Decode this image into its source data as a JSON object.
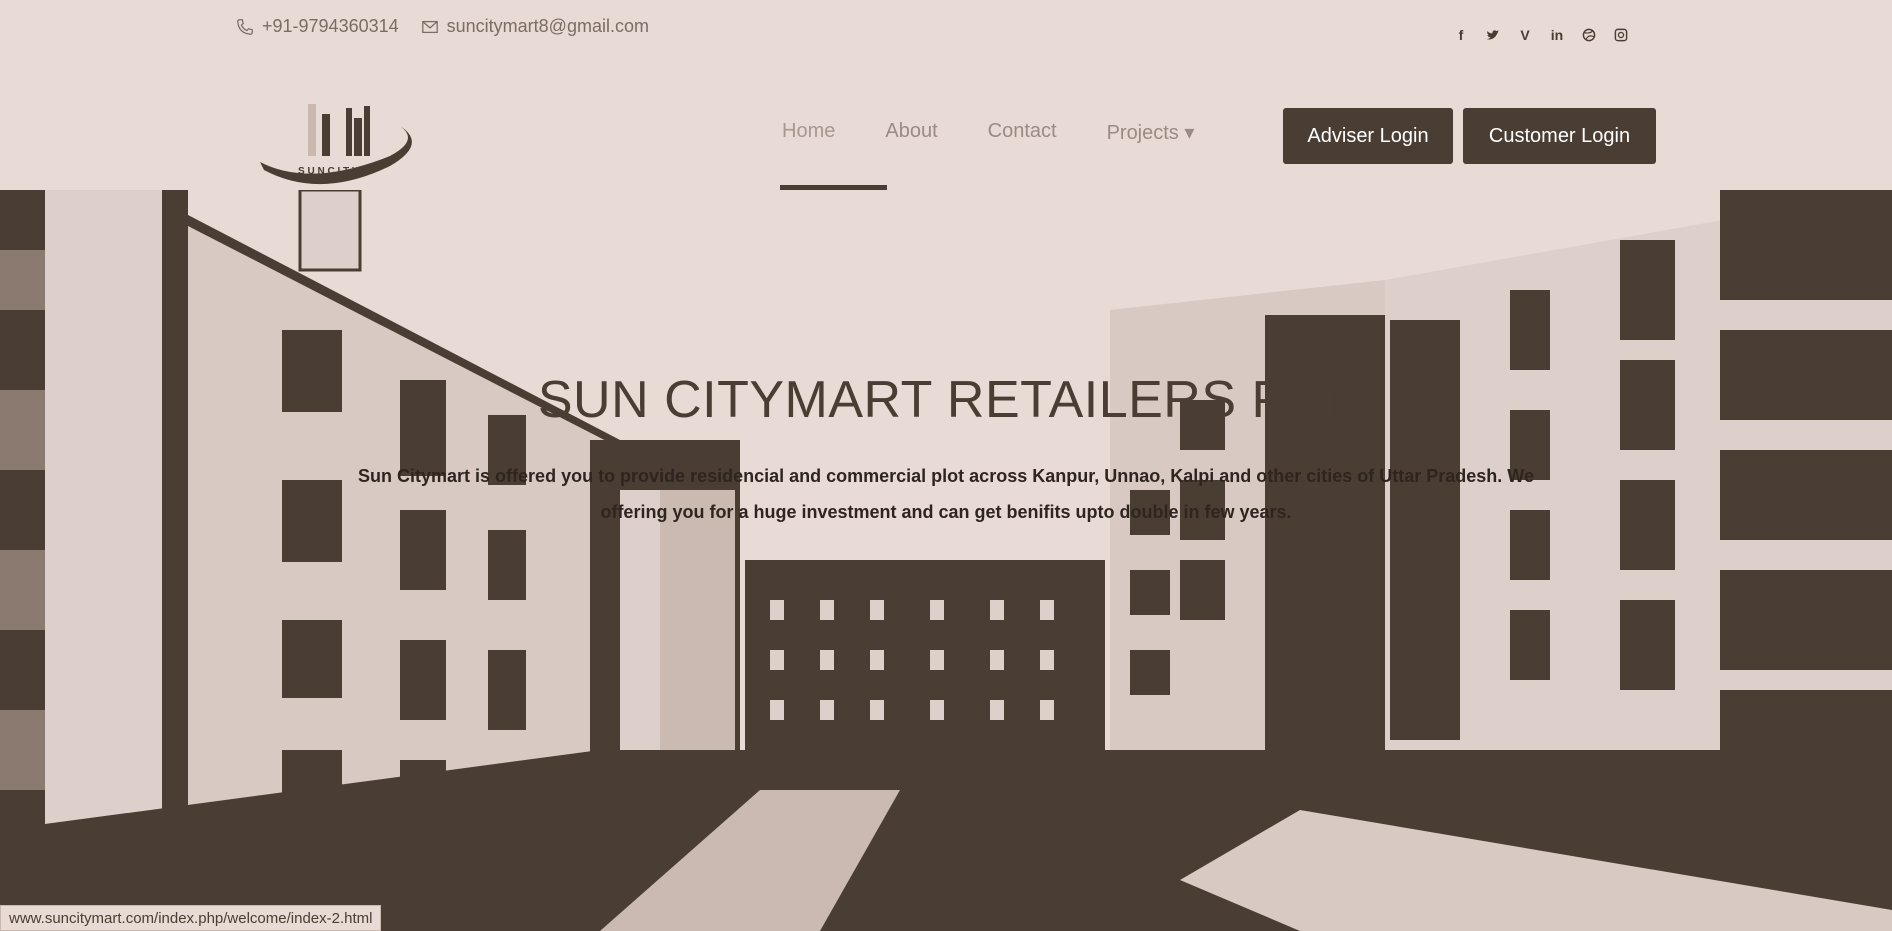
{
  "topbar": {
    "phone": "+91-9794360314",
    "email": "suncitymart8@gmail.com",
    "social": [
      "f",
      "t",
      "v",
      "in",
      "dribbble",
      "instagram"
    ]
  },
  "logo": {
    "alt": "Sun Citymart"
  },
  "nav": {
    "items": [
      {
        "label": "Home",
        "active": true
      },
      {
        "label": "About"
      },
      {
        "label": "Contact"
      },
      {
        "label": "Projects ▾"
      }
    ],
    "adviser_login": "Adviser Login",
    "customer_login": "Customer Login"
  },
  "hero": {
    "title": "SUN CITYMART RETAILERS PVT",
    "subtitle": "Sun Citymart is offered you to provide residencial and commercial plot across Kanpur, Unnao, Kalpi and other cities of Uttar Pradesh. We offering you for a huge investment and can get benifits upto double in few years."
  },
  "status": {
    "url": "www.suncitymart.com/index.php/welcome/index-2.html"
  },
  "colors": {
    "background": "#e8dad4",
    "dark": "#4a3d33",
    "button": "#4a3d33"
  }
}
